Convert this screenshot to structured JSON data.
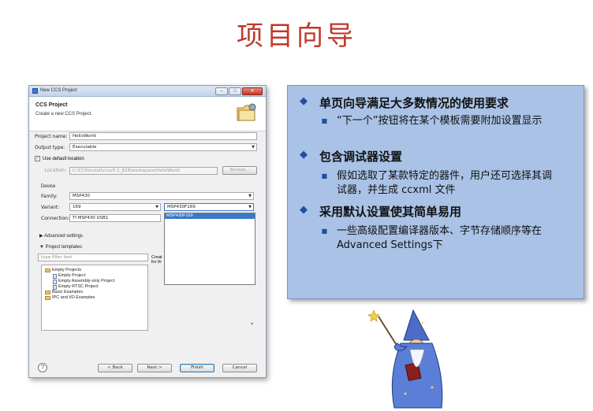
{
  "slide": {
    "title": "项目向导"
  },
  "dialog": {
    "window_title": "New CCS Project",
    "header_title": "CCS Project",
    "header_subtitle": "Create a new CCS Project.",
    "project_name_label": "Project name:",
    "project_name_value": "HelloWorld",
    "output_type_label": "Output type:",
    "output_type_value": "Executable",
    "use_default_location_label": "Use default location",
    "location_label": "Location:",
    "location_value": "C:\\CCS\\install\\ccsv5.1_828\\workspace\\HelloWorld",
    "browse_label": "Browse...",
    "device_label": "Device",
    "family_label": "Family:",
    "family_value": "MSP430",
    "variant_label": "Variant:",
    "variant_filter_value": "169",
    "variant_value": "MSP430F169",
    "connection_label": "Connection:",
    "connection_value": "TI MSP430 USB1",
    "dropdown_options": [
      "MSP430F169"
    ],
    "advanced_settings_label": "Advanced settings",
    "project_templates_label": "Project templates",
    "filter_placeholder": "type filter text",
    "description_text": "Creat",
    "description_text_2": "for th",
    "tree": [
      {
        "label": "Empty Projects",
        "type": "folder"
      },
      {
        "label": "Empty Project",
        "type": "file"
      },
      {
        "label": "Empty Assembly-only Project",
        "type": "file"
      },
      {
        "label": "Empty RTSC Project",
        "type": "file"
      },
      {
        "label": "Basic Examples",
        "type": "folder"
      },
      {
        "label": "IPC and I/O Examples",
        "type": "folder"
      }
    ],
    "back_label": "< Back",
    "next_label": "Next >",
    "finish_label": "Finish",
    "cancel_label": "Cancel",
    "help_symbol": "?"
  },
  "info": {
    "items": [
      {
        "text": "单页向导满足大多数情况的使用要求",
        "sub": "“下一个”按钮将在某个模板需要附加设置显示"
      },
      {
        "text": "包含调试器设置",
        "sub": "假如选取了某款特定的器件，用户还可选择其调试器，并生成 ccxml 文件"
      },
      {
        "text": "采用默认设置使其简单易用",
        "sub": "一些高级配置编译器版本、字节存储顺序等在 Advanced Settings下"
      }
    ]
  },
  "colors": {
    "title": "#c0392b",
    "info_box": "#a9c2e6",
    "bullet": "#1f4fa0",
    "selection": "#3b78c9"
  }
}
